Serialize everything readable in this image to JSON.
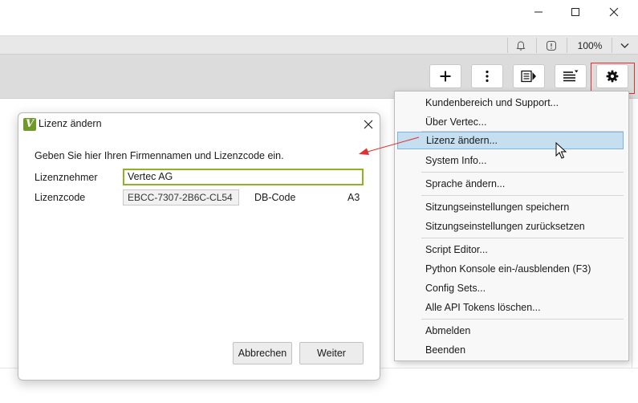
{
  "window": {
    "minimize_icon": "minimize-icon",
    "maximize_icon": "maximize-icon",
    "close_icon": "close-icon"
  },
  "status_strip": {
    "bell_icon": "bell-icon",
    "alert_icon": "alert-icon",
    "zoom": "100%",
    "zoom_dropdown_icon": "chevron-down-icon"
  },
  "toolbar": {
    "buttons": [
      {
        "name": "add-button",
        "icon": "plus-icon"
      },
      {
        "name": "more-button",
        "icon": "kebab-icon"
      },
      {
        "name": "panel-button",
        "icon": "panel-arrow-icon"
      },
      {
        "name": "list-menu-button",
        "icon": "list-dropdown-icon"
      },
      {
        "name": "settings-button",
        "icon": "gear-icon"
      }
    ],
    "highlight_color": "#e0302f"
  },
  "dialog": {
    "title": "Lizenz ändern",
    "logo_letter": "V",
    "instruction": "Geben Sie hier Ihren Firmennamen und Lizenzcode ein.",
    "licensee_label": "Lizenznehmer",
    "licensee_value": "Vertec AG",
    "license_code_label": "Lizenzcode",
    "license_code_value": "EBCC-7307-2B6C-CL54",
    "db_code_label": "DB-Code",
    "db_code_value": "A3",
    "cancel_label": "Abbrechen",
    "next_label": "Weiter",
    "accent_color": "#8fb324"
  },
  "menu": {
    "items": [
      {
        "label": "Kundenbereich und Support..."
      },
      {
        "label": "Über Vertec..."
      },
      {
        "label": "Lizenz ändern...",
        "active": true
      },
      {
        "label": "System Info..."
      },
      {
        "label": "Sprache ändern..."
      },
      {
        "label": "Sitzungseinstellungen speichern"
      },
      {
        "label": "Sitzungseinstellungen zurücksetzen"
      },
      {
        "label": "Script Editor..."
      },
      {
        "label": "Python Konsole ein-/ausblenden (F3)"
      },
      {
        "label": "Config Sets..."
      },
      {
        "label": "Alle API Tokens löschen..."
      },
      {
        "label": "Abmelden"
      },
      {
        "label": "Beenden"
      }
    ],
    "highlight_color": "#c5dff1"
  },
  "annotation": {
    "arrow_color": "#e0302f"
  }
}
